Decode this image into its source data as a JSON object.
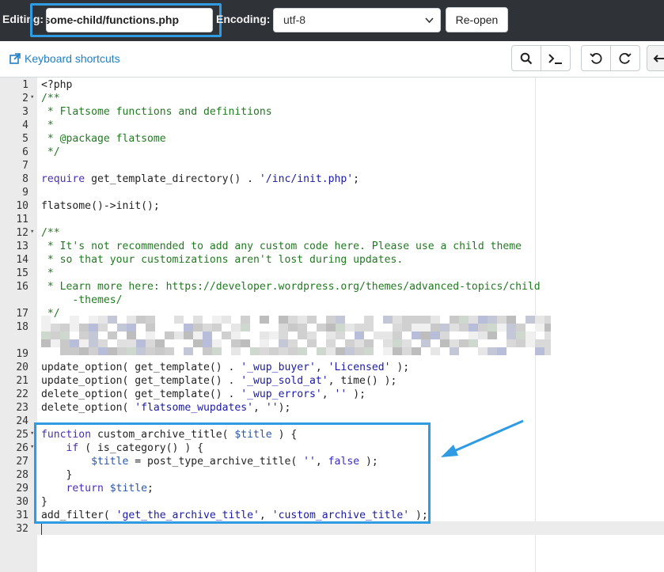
{
  "header": {
    "editing_label": "Editing:",
    "file_value": ":some-child/functions.php",
    "encoding_label": "Encoding:",
    "encoding_value": "utf-8",
    "reopen_label": "Re-open"
  },
  "toolbar": {
    "keyboard_shortcuts": "Keyboard shortcuts",
    "buttons": [
      "search-icon",
      "terminal-icon",
      "undo-icon",
      "redo-icon",
      "back-icon"
    ]
  },
  "editor": {
    "line_numbers": [
      "1",
      "2",
      "3",
      "4",
      "5",
      "6",
      "7",
      "8",
      "9",
      "10",
      "11",
      "12",
      "13",
      "14",
      "15",
      "16",
      "17",
      "18",
      "19",
      "20",
      "21",
      "22",
      "23",
      "24",
      "25",
      "26",
      "27",
      "28",
      "29",
      "30",
      "31",
      "32"
    ],
    "lines": {
      "l1": "<?php",
      "l2": "/**",
      "l3": " * Flatsome functions and definitions",
      "l4": " *",
      "l5": " * @package flatsome",
      "l6": " */",
      "l8a": "require",
      "l8b": " get_template_directory() . ",
      "l8c": "'/inc/init.php'",
      "l8d": ";",
      "l10": "flatsome()->init();",
      "l12": "/**",
      "l13": " * It's not recommended to add any custom code here. Please use a child theme",
      "l14": " * so that your customizations aren't lost during updates.",
      "l15": " *",
      "l16": " * Learn more here: https://developer.wordpress.org/themes/advanced-topics/child",
      "l16b": "     -themes/",
      "l17": " */",
      "l20a": "update_option( get_template() . ",
      "l20b": "'_wup_buyer'",
      "l20c": ", ",
      "l20d": "'Licensed'",
      "l20e": " );",
      "l21a": "update_option( get_template() . ",
      "l21b": "'_wup_sold_at'",
      "l21c": ", time() );",
      "l22a": "delete_option( get_template() . ",
      "l22b": "'_wup_errors'",
      "l22c": ", ",
      "l22d": "''",
      "l22e": " );",
      "l23a": "delete_option( ",
      "l23b": "'flatsome_wupdates'",
      "l23c": ", ",
      "l23d": "''",
      "l23e": ");",
      "l25a": "function",
      "l25b": " custom_archive_title( ",
      "l25c": "$title",
      "l25d": " ) {",
      "l26a": "    if",
      "l26b": " ( is_category() ) {",
      "l27a": "        $title",
      "l27b": " = post_type_archive_title( ",
      "l27c": "''",
      "l27d": ", ",
      "l27e": "false",
      "l27f": " );",
      "l28": "    }",
      "l29a": "    return",
      "l29b": " $title",
      "l29c": ";",
      "l30": "}",
      "l31a": "add_filter( ",
      "l31b": "'get_the_archive_title'",
      "l31c": ", ",
      "l31d": "'custom_archive_title'",
      "l31e": " );"
    }
  },
  "colors": {
    "accent": "#2e9be3",
    "topbar_bg": "#2f3237",
    "link": "#1f7fc4"
  }
}
